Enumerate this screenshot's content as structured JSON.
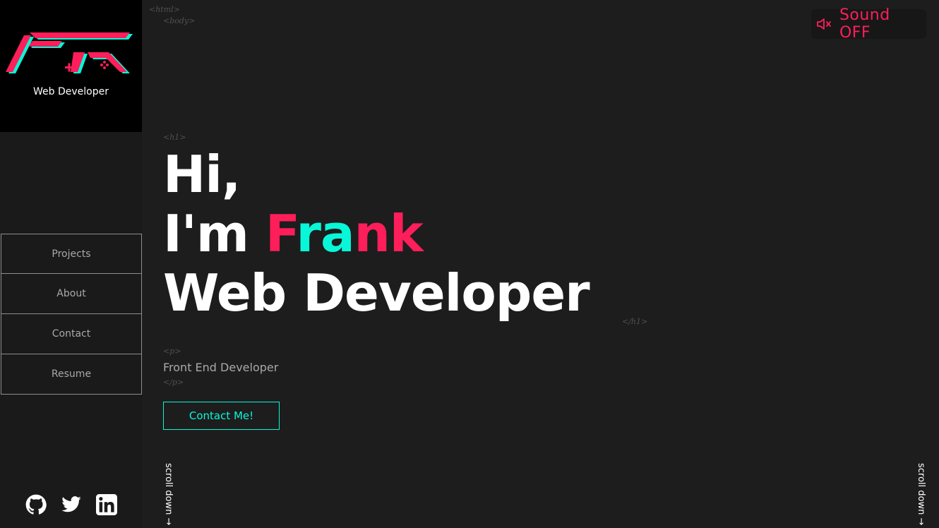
{
  "sidebar": {
    "logo_text": "Web Developer",
    "nav": [
      "Projects",
      "About",
      "Contact",
      "Resume"
    ],
    "socials": [
      "github-icon",
      "twitter-icon",
      "linkedin-icon"
    ]
  },
  "tags": {
    "html_open": "<html>",
    "body_open": "<body>",
    "h1_open": "<h1>",
    "h1_close": "</h1>",
    "p_open": "<p>",
    "p_close": "</p>"
  },
  "hero": {
    "line1": "Hi,",
    "line2_prefix": "I'm ",
    "name_part1": "F",
    "name_part2": "ra",
    "name_part3": "nk",
    "line3": "Web Developer",
    "subtitle": "Front End Developer",
    "cta": "Contact Me!"
  },
  "sound": {
    "label": "Sound OFF",
    "icon": "speaker-muted-icon"
  },
  "scroll_label": "scroll down →",
  "colors": {
    "accent_pink": "#fe1e5a",
    "accent_cyan": "#08f7d8",
    "background": "#1d1d1d"
  }
}
